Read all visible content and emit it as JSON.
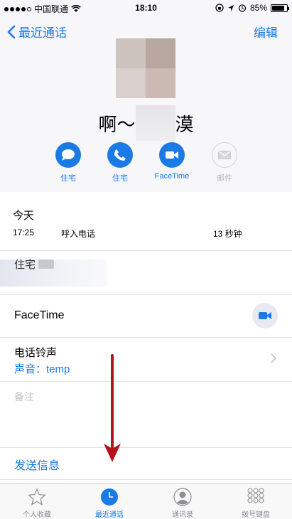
{
  "status_bar": {
    "carrier": "中国联通",
    "time": "18:10",
    "battery": "85%",
    "battery_level": 0.85
  },
  "nav": {
    "back_label": "最近通话",
    "edit_label": "编辑"
  },
  "contact": {
    "name_prefix": "啊～",
    "name_suffix": "漠"
  },
  "actions": [
    {
      "label": "住宅",
      "icon": "message-icon",
      "enabled": true
    },
    {
      "label": "住宅",
      "icon": "phone-icon",
      "enabled": true
    },
    {
      "label": "FaceTime",
      "icon": "video-icon",
      "enabled": true
    },
    {
      "label": "邮件",
      "icon": "mail-icon",
      "enabled": false
    }
  ],
  "recent": {
    "title": "今天",
    "time": "17:25",
    "type": "呼入电话",
    "duration": "13 秒钟"
  },
  "phone": {
    "label": "住宅"
  },
  "facetime": {
    "label": "FaceTime"
  },
  "ringtone": {
    "label": "电话铃声",
    "value": "声音：temp"
  },
  "notes": {
    "placeholder": "备注"
  },
  "send": {
    "label": "发送信息"
  },
  "tabs": [
    {
      "label": "个人收藏",
      "icon": "star-icon",
      "active": false
    },
    {
      "label": "最近通话",
      "icon": "clock-icon",
      "active": true
    },
    {
      "label": "通讯录",
      "icon": "contacts-icon",
      "active": false
    },
    {
      "label": "拨号键盘",
      "icon": "keypad-icon",
      "active": false
    }
  ],
  "colors": {
    "accent": "#1a7ae6",
    "annotation_arrow": "#b5121b"
  }
}
